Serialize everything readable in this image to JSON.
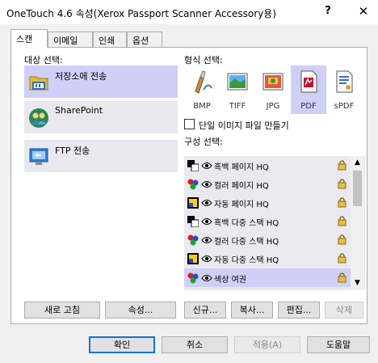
{
  "window": {
    "title": "OneTouch 4.6 속성(Xerox Passport Scanner Accessory용)",
    "help_label": "?",
    "close_label": "✕"
  },
  "tabs": [
    {
      "label": "스캔",
      "active": true
    },
    {
      "label": "이메일",
      "active": false
    },
    {
      "label": "인쇄",
      "active": false
    },
    {
      "label": "옵션",
      "active": false
    }
  ],
  "destination": {
    "heading": "대상 선택:",
    "items": [
      {
        "label": "저장소에 전송",
        "icon": "folder-storage-icon",
        "selected": true
      },
      {
        "label": "SharePoint",
        "icon": "sharepoint-icon",
        "selected": false
      },
      {
        "label": "FTP 전송",
        "icon": "ftp-icon",
        "selected": false
      }
    ]
  },
  "format": {
    "heading": "형식 선택:",
    "items": [
      {
        "label": "BMP",
        "icon": "bmp-paint-icon",
        "selected": false
      },
      {
        "label": "TIFF",
        "icon": "tiff-image-icon",
        "selected": false
      },
      {
        "label": "JPG",
        "icon": "jpg-image-icon",
        "selected": false
      },
      {
        "label": "PDF",
        "icon": "pdf-document-icon",
        "selected": true
      },
      {
        "label": "sPDF",
        "icon": "spdf-document-icon",
        "selected": false
      }
    ],
    "single_file_label": "단일 이미지 파일 만들기",
    "single_file_checked": false
  },
  "configuration": {
    "heading": "구성 선택:",
    "items": [
      {
        "label": "흑백 페이지 HQ",
        "icon": "bw-page-icon",
        "selected": false
      },
      {
        "label": "컬러 페이지 HQ",
        "icon": "color-page-icon",
        "selected": false
      },
      {
        "label": "자동 페이지 HQ",
        "icon": "auto-page-icon",
        "selected": false
      },
      {
        "label": "흑백 다중 스택 HQ",
        "icon": "bw-page-icon",
        "selected": false
      },
      {
        "label": "컬러 다중 스택 HQ",
        "icon": "color-page-icon",
        "selected": false
      },
      {
        "label": "자동 다중 스택 HQ",
        "icon": "auto-page-icon",
        "selected": false
      },
      {
        "label": "색상 여권",
        "icon": "color-page-icon",
        "selected": true
      }
    ],
    "scroll_up": "▲",
    "scroll_down": "▼"
  },
  "panel_buttons": {
    "refresh": "새로 고침",
    "properties": "속성...",
    "new": "신규...",
    "copy": "복사...",
    "edit": "편집...",
    "delete": "삭제"
  },
  "dialog_buttons": {
    "ok": "확인",
    "cancel": "취소",
    "apply": "적용(A)",
    "help": "도움말"
  },
  "colors": {
    "selection": "#cfcff7",
    "default_button_border": "#0078d7"
  }
}
